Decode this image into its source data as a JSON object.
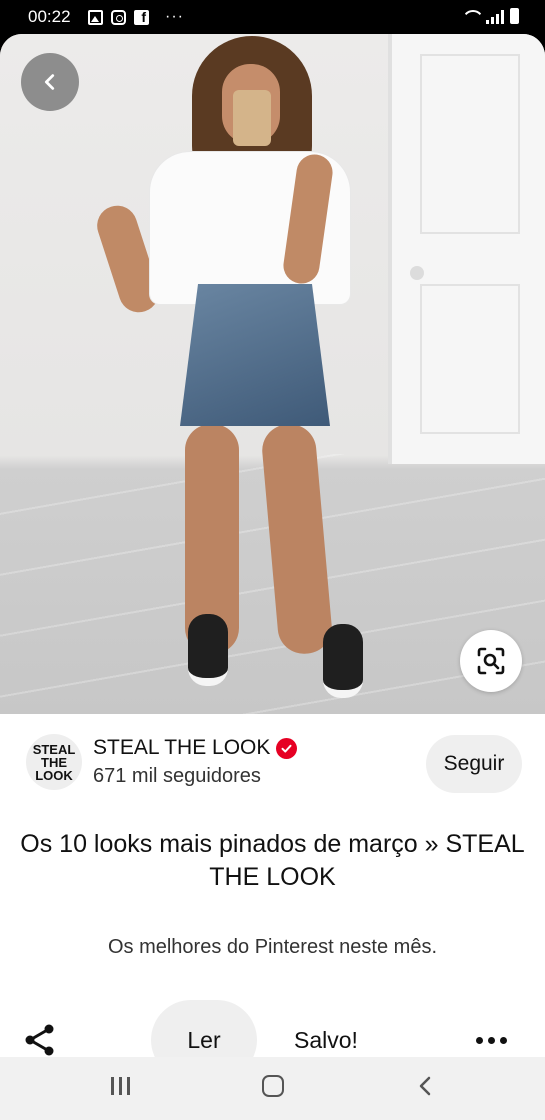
{
  "status_bar": {
    "time": "00:22",
    "notification_icons": [
      "gallery-icon",
      "instagram-icon",
      "facebook-icon"
    ],
    "more": "···",
    "system_icons": [
      "wifi-icon",
      "signal-icon",
      "battery-icon"
    ]
  },
  "pin": {
    "image_description_icon": "photo",
    "title": "Os 10 looks mais pinados de março » STEAL THE LOOK",
    "description": "Os melhores do Pinterest neste mês."
  },
  "creator": {
    "avatar_lines": [
      "STEAL",
      "THE",
      "LOOK"
    ],
    "name": "STEAL THE LOOK",
    "followers": "671 mil seguidores",
    "follow_label": "Seguir"
  },
  "actions": {
    "read_label": "Ler",
    "saved_label": "Salvo!"
  },
  "colors": {
    "brand_red": "#e60023",
    "button_gray": "#efefef",
    "nav_bar": "#f1f1f1"
  }
}
